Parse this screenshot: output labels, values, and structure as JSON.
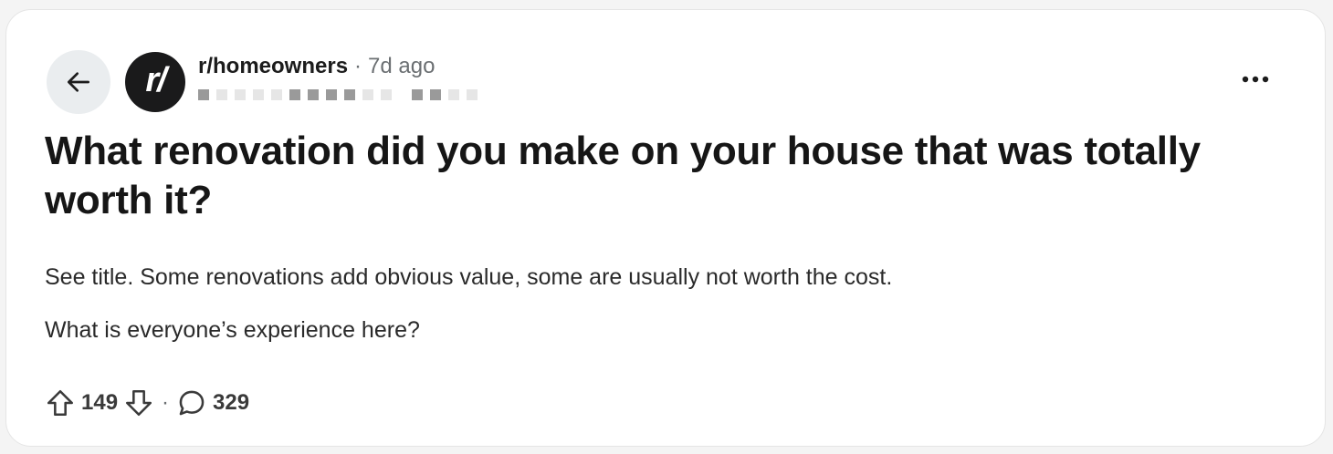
{
  "post": {
    "subreddit": "r/homeowners",
    "separator": "·",
    "time_ago": "7d ago",
    "avatar_text": "r/",
    "title": "What renovation did you make on your house that was totally worth it?",
    "body": [
      "See title. Some renovations add obvious value, some are usually not worth the cost.",
      "What is everyone’s experience here?"
    ],
    "votes": "149",
    "comments": "329"
  },
  "icons": {
    "back": "arrow-left-icon",
    "more": "ellipsis-icon",
    "upvote": "arrow-up-outline-icon",
    "downvote": "arrow-down-outline-icon",
    "comments": "speech-bubble-icon"
  },
  "colors": {
    "card_bg": "#ffffff",
    "page_bg": "#f4f4f4",
    "back_btn_bg": "#eaedef",
    "avatar_bg": "#1a1a1b",
    "muted_text": "#6b6f72"
  }
}
